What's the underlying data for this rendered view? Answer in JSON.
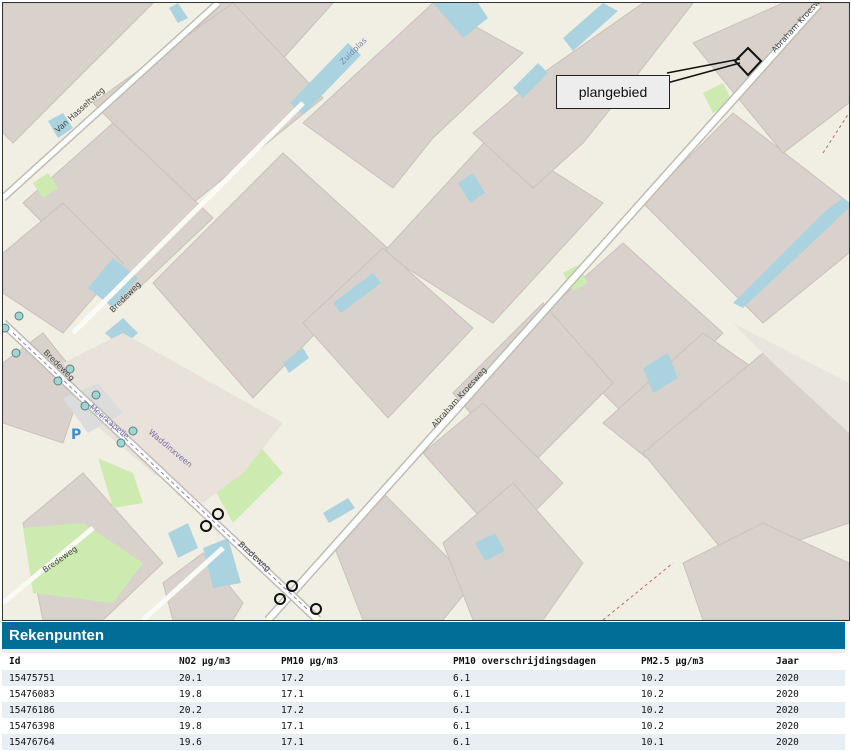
{
  "map": {
    "callout_label": "plangebied",
    "street_labels": {
      "abraham_kroesweg_top": "Abraham Kroesweg",
      "abraham_kroesweg_mid": "Abraham Kroesweg",
      "zuidplas": "Zuidplas",
      "van_hasseltweg": "Van Hasseltweg",
      "bredeweg_1": "Bredeweg",
      "bredeweg_2": "Bredeweg",
      "bredeweg_3": "Bredeweg",
      "bredeweg_4": "Bredeweg",
      "moerkapelle": "Moerkapelle",
      "waddinxveen": "Waddinxveen"
    },
    "parking_label": "P",
    "colors": {
      "land": "#f1efe3",
      "greenhouse": "#d9d2cc",
      "water": "#aad3df",
      "grass": "#cdebb0",
      "road": "#ffffff",
      "road_border": "#bdbdb3",
      "marker_stroke": "#111111",
      "panel_header": "#006e96"
    }
  },
  "results": {
    "title": "Rekenpunten",
    "columns": [
      "Id",
      "NO2 µg/m3",
      "PM10 µg/m3",
      "PM10 overschrijdingsdagen",
      "PM2.5 µg/m3",
      "Jaar"
    ],
    "rows": [
      [
        "15475751",
        "20.1",
        "17.2",
        "6.1",
        "10.2",
        "2020"
      ],
      [
        "15476083",
        "19.8",
        "17.1",
        "6.1",
        "10.2",
        "2020"
      ],
      [
        "15476186",
        "20.2",
        "17.2",
        "6.1",
        "10.2",
        "2020"
      ],
      [
        "15476398",
        "19.8",
        "17.1",
        "6.1",
        "10.2",
        "2020"
      ],
      [
        "15476764",
        "19.6",
        "17.1",
        "6.1",
        "10.1",
        "2020"
      ]
    ]
  }
}
